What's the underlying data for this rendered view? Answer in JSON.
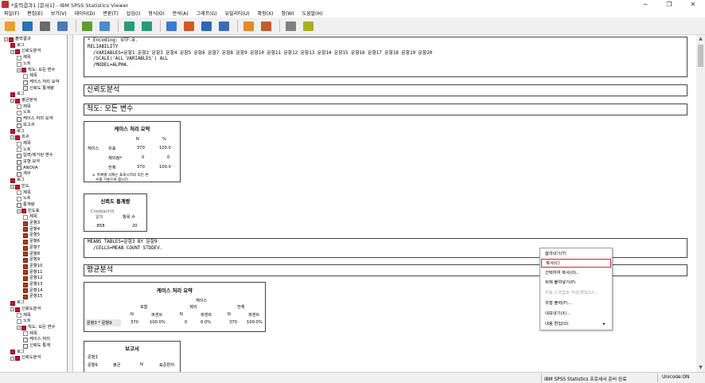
{
  "window": {
    "title": "*출력결과1 [문서1] - IBM SPSS Statistics Viewer",
    "minimize": "─",
    "maximize": "❐",
    "close": "✕"
  },
  "menu": [
    "파일(F)",
    "편집(E)",
    "보기(V)",
    "데이터(D)",
    "변환(T)",
    "삽입(I)",
    "형식(O)",
    "분석(A)",
    "그래프(G)",
    "유틸리티(U)",
    "확장(X)",
    "창(W)",
    "도움말(H)"
  ],
  "toolbar": [
    "open-icon",
    "save-icon",
    "print-icon",
    "print-preview-icon",
    "export-icon",
    "recall-dialog-icon",
    "undo-icon",
    "redo-icon",
    "goto-data-icon",
    "goto-case-icon",
    "goto-variable-icon",
    "variables-icon",
    "create-title-icon",
    "insert-output-icon",
    "designate-window-icon",
    "run-script-icon"
  ],
  "nav": [
    {
      "label": "출력결과",
      "icon": "book",
      "pm": "−",
      "indent": 0
    },
    {
      "label": "로그",
      "icon": "book",
      "indent": 1
    },
    {
      "label": "신뢰도분석",
      "icon": "book",
      "pm": "−",
      "indent": 1
    },
    {
      "label": "제목",
      "icon": "page",
      "indent": 2
    },
    {
      "label": "노트",
      "icon": "page",
      "indent": 2
    },
    {
      "label": "척도: 모든 변수",
      "icon": "book",
      "pm": "−",
      "indent": 2
    },
    {
      "label": "제목",
      "icon": "page",
      "indent": 3
    },
    {
      "label": "케이스 처리 요약",
      "icon": "tab",
      "indent": 3
    },
    {
      "label": "신뢰도 통계량",
      "icon": "tab",
      "indent": 3
    },
    {
      "label": "로그",
      "icon": "book",
      "indent": 1
    },
    {
      "label": "평균분석",
      "icon": "book",
      "pm": "−",
      "indent": 1
    },
    {
      "label": "제목",
      "icon": "page",
      "indent": 2
    },
    {
      "label": "노트",
      "icon": "page",
      "indent": 2
    },
    {
      "label": "케이스 처리 요약",
      "icon": "tab",
      "indent": 2
    },
    {
      "label": "보고서",
      "icon": "tab",
      "indent": 2
    },
    {
      "label": "로그",
      "icon": "book",
      "indent": 1
    },
    {
      "label": "회귀",
      "icon": "book",
      "pm": "−",
      "indent": 1
    },
    {
      "label": "제목",
      "icon": "page",
      "indent": 2
    },
    {
      "label": "노트",
      "icon": "page",
      "indent": 2
    },
    {
      "label": "입력/제거된 변수",
      "icon": "tab",
      "indent": 2
    },
    {
      "label": "모형 요약",
      "icon": "tab",
      "indent": 2
    },
    {
      "label": "ANOVA",
      "icon": "tab",
      "indent": 2
    },
    {
      "label": "계수",
      "icon": "tab",
      "indent": 2
    },
    {
      "label": "로그",
      "icon": "book",
      "indent": 1
    },
    {
      "label": "빈도",
      "icon": "book",
      "pm": "−",
      "indent": 1
    },
    {
      "label": "제목",
      "icon": "page",
      "indent": 2
    },
    {
      "label": "노트",
      "icon": "page",
      "indent": 2
    },
    {
      "label": "통계량",
      "icon": "tab",
      "indent": 2
    },
    {
      "label": "빈도표",
      "icon": "book",
      "pm": "−",
      "indent": 2
    },
    {
      "label": "제목",
      "icon": "page",
      "indent": 3
    },
    {
      "label": "문항3",
      "icon": "chart",
      "indent": 3
    },
    {
      "label": "문항4",
      "icon": "chart",
      "indent": 3
    },
    {
      "label": "문항5",
      "icon": "chart",
      "indent": 3
    },
    {
      "label": "문항6",
      "icon": "chart",
      "indent": 3
    },
    {
      "label": "문항7",
      "icon": "chart",
      "indent": 3
    },
    {
      "label": "문항8",
      "icon": "chart",
      "indent": 3
    },
    {
      "label": "문항9",
      "icon": "chart",
      "indent": 3
    },
    {
      "label": "문항10",
      "icon": "chart",
      "indent": 3
    },
    {
      "label": "문항11",
      "icon": "chart",
      "indent": 3
    },
    {
      "label": "문항12",
      "icon": "chart",
      "indent": 3
    },
    {
      "label": "문항13",
      "icon": "chart",
      "indent": 3
    },
    {
      "label": "문항14",
      "icon": "chart",
      "indent": 3
    },
    {
      "label": "문항15",
      "icon": "chart",
      "indent": 3
    },
    {
      "label": "로그",
      "icon": "book",
      "indent": 1
    },
    {
      "label": "신뢰도분석",
      "icon": "book",
      "pm": "−",
      "indent": 1
    },
    {
      "label": "제목",
      "icon": "page",
      "indent": 2
    },
    {
      "label": "노트",
      "icon": "page",
      "indent": 2
    },
    {
      "label": "척도: 모든 변수",
      "icon": "book",
      "pm": "−",
      "indent": 2
    },
    {
      "label": "제목",
      "icon": "page",
      "indent": 3
    },
    {
      "label": "케이스 처리",
      "icon": "tab",
      "indent": 3
    },
    {
      "label": "신뢰도 통계",
      "icon": "tab",
      "indent": 3
    },
    {
      "label": "로그",
      "icon": "book",
      "indent": 1
    },
    {
      "label": "신뢰도분석",
      "icon": "book",
      "pm": "−",
      "indent": 1
    }
  ],
  "syntax1": "* Encoding: UTF-8.\nRELIABILITY\n  /VARIABLES=문항1 문항2 문항3 문항4 문항5 문항6 문항7 문항8 문항9 문항10 문항11 문항12 문항13 문항14 문항15 문항16 문항17 문항18 문항19 문항20\n  /SCALE('ALL VARIABLES') ALL\n  /MODEL=ALPHA.",
  "heading1": "신뢰도분석",
  "heading2": "척도: 모든 변수",
  "case_table": {
    "title": "케이스 처리 요약",
    "col_n": "N",
    "col_pct": "%",
    "row_group": "케이스",
    "rows": [
      {
        "label": "유효",
        "n": "370",
        "pct": "100.0"
      },
      {
        "label": "제외됨ª",
        "n": "0",
        "pct": "0"
      },
      {
        "label": "전체",
        "n": "370",
        "pct": "100.0"
      }
    ],
    "footnote1": "a. 목록별 삭제는 프로시저의 모든 변",
    "footnote2": "수를 기준으로 합니다."
  },
  "rel_table": {
    "title": "신뢰도 통계량",
    "col1a": "Cronbach의",
    "col1b": "알파",
    "col2": "항목 수",
    "alpha": ".858",
    "items": "20"
  },
  "syntax2": "MEANS TABLES=문항3 BY 문항9\n  /CELLS=MEAN COUNT STDDEV.",
  "heading3": "평균분석",
  "case_table2": {
    "title": "케이스 처리 요약",
    "case": "케이스",
    "included": "포함",
    "excluded": "제외",
    "total": "전체",
    "n": "N",
    "pct": "퍼센트",
    "row_label": "문항3 * 문항9",
    "vals": [
      "370",
      "100.0%",
      "0",
      "0.0%",
      "370",
      "100.0%"
    ]
  },
  "report": {
    "title": "보고서",
    "var": "문항3",
    "col_group": "문항9",
    "col_mean": "평균",
    "col_n": "N",
    "col_sd": "표준편차"
  },
  "context_menu": [
    "잘라내기(T)",
    "복사(C)",
    "선택하여 복사(O)...",
    "뒤에 붙여넣기(P)",
    "자동 스크립트 작성/편집(U)...",
    "유형 출력(F)...",
    "내보내기(X)...",
    "내용 편집(O)"
  ],
  "context_arrow": "▸",
  "status": {
    "processor": "IBM SPSS Statistics 프로세서 준비 완료",
    "unicode": "Unicode:ON"
  }
}
